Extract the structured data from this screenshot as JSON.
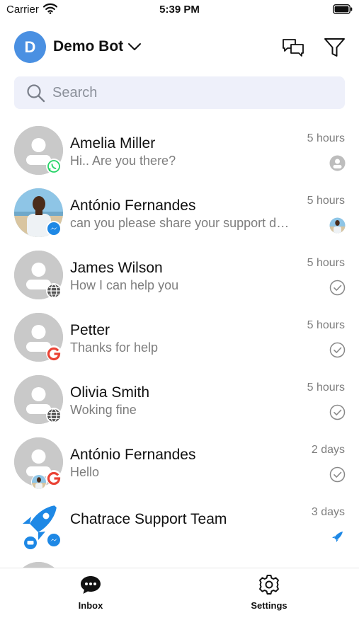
{
  "status_bar": {
    "carrier": "Carrier",
    "time": "5:39 PM"
  },
  "header": {
    "avatar_letter": "D",
    "bot_name": "Demo Bot",
    "accent_color": "#4a90e2"
  },
  "search": {
    "placeholder": "Search",
    "value": ""
  },
  "conversations": [
    {
      "name": "Amelia Miller",
      "preview": "Hi.. Are you there?",
      "time": "5 hours",
      "avatar": "placeholder-avatar",
      "channel": "whatsapp-icon",
      "status": "assignee-icon"
    },
    {
      "name": "António Fernandes",
      "preview": "can you please share your support details?",
      "time": "5 hours",
      "avatar": "profile-photo",
      "channel": "messenger-icon",
      "status": "assignee-photo"
    },
    {
      "name": "James Wilson",
      "preview": "How I can help you",
      "time": "5 hours",
      "avatar": "placeholder-avatar",
      "channel": "web-globe-icon",
      "status": "check-circle-icon"
    },
    {
      "name": "Petter",
      "preview": "Thanks for help",
      "time": "5 hours",
      "avatar": "placeholder-avatar",
      "channel": "google-icon",
      "status": "check-circle-icon"
    },
    {
      "name": "Olivia Smith",
      "preview": "Woking fine",
      "time": "5 hours",
      "avatar": "placeholder-avatar",
      "channel": "web-globe-icon",
      "status": "check-circle-icon"
    },
    {
      "name": "António Fernandes",
      "preview": "Hello",
      "time": "2 days",
      "avatar": "placeholder-avatar",
      "channel": "google-icon",
      "status": "check-circle-icon"
    },
    {
      "name": "Chatrace Support Team",
      "preview": "",
      "time": "3 days",
      "avatar": "rocket-logo",
      "channel": "messenger-icon",
      "status": "rocket-icon"
    }
  ],
  "tabs": [
    {
      "label": "Inbox",
      "icon": "chat-bubble-icon"
    },
    {
      "label": "Settings",
      "icon": "gear-icon"
    }
  ]
}
